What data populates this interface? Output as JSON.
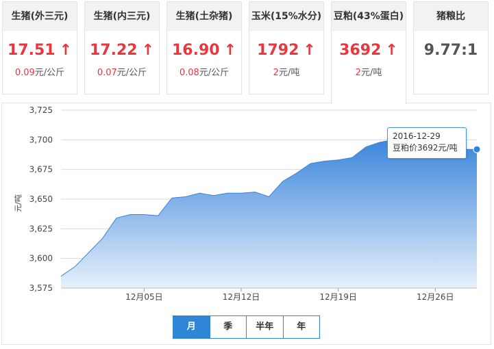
{
  "cards": [
    {
      "title": "生猪(外三元)",
      "price": "17.51",
      "arrow": "↑",
      "change_value": "0.09",
      "change_unit": "元/公斤"
    },
    {
      "title": "生猪(内三元)",
      "price": "17.22",
      "arrow": "↑",
      "change_value": "0.07",
      "change_unit": "元/公斤"
    },
    {
      "title": "生猪(土杂猪)",
      "price": "16.90",
      "arrow": "↑",
      "change_value": "0.08",
      "change_unit": "元/公斤"
    },
    {
      "title": "玉米(15%水分)",
      "price": "1792",
      "arrow": "↑",
      "change_value": "2",
      "change_unit": "元/吨"
    },
    {
      "title": "豆粕(43%蛋白)",
      "price": "3692",
      "arrow": "↑",
      "change_value": "2",
      "change_unit": "元/吨"
    },
    {
      "title": "猪粮比",
      "ratio": "9.77:1"
    }
  ],
  "active_card": 4,
  "colors": {
    "up": "#e8373f",
    "accent": "#2f86d6",
    "line": "#3b82d6",
    "fill_top": "#3c86db",
    "fill_bottom": "#e6f0fb"
  },
  "tooltip": {
    "date": "2016-12-29",
    "text": "豆粕价3692元/吨"
  },
  "range_tabs": [
    {
      "label": "月",
      "active": true
    },
    {
      "label": "季",
      "active": false
    },
    {
      "label": "半年",
      "active": false
    },
    {
      "label": "年",
      "active": false
    }
  ],
  "chart_data": {
    "type": "area",
    "ylabel": "元/吨",
    "ylim": [
      3575,
      3725
    ],
    "yticks": [
      3575,
      3600,
      3625,
      3650,
      3675,
      3700,
      3725
    ],
    "ytick_labels": [
      "3,575",
      "3,600",
      "3,625",
      "3,650",
      "3,675",
      "3,700",
      "3,725"
    ],
    "x_dates": [
      "11-29",
      "11-30",
      "12-01",
      "12-02",
      "12-03",
      "12-04",
      "12-05",
      "12-06",
      "12-07",
      "12-08",
      "12-09",
      "12-10",
      "12-11",
      "12-12",
      "12-13",
      "12-14",
      "12-15",
      "12-16",
      "12-17",
      "12-18",
      "12-19",
      "12-20",
      "12-21",
      "12-22",
      "12-23",
      "12-24",
      "12-25",
      "12-26",
      "12-27",
      "12-28",
      "12-29"
    ],
    "values": [
      3585,
      3593,
      3605,
      3617,
      3634,
      3637,
      3637,
      3636,
      3651,
      3652,
      3655,
      3653,
      3655,
      3655,
      3656,
      3652,
      3665,
      3672,
      3680,
      3682,
      3683,
      3685,
      3694,
      3698,
      3700,
      3700,
      3696,
      3694,
      3693,
      3692,
      3692
    ],
    "xtick_labels": [
      {
        "index": 6,
        "label": "12月05日"
      },
      {
        "index": 13,
        "label": "12月12日"
      },
      {
        "index": 20,
        "label": "12月19日"
      },
      {
        "index": 27,
        "label": "12月26日"
      }
    ],
    "grid": true,
    "highlight_index": 30
  }
}
